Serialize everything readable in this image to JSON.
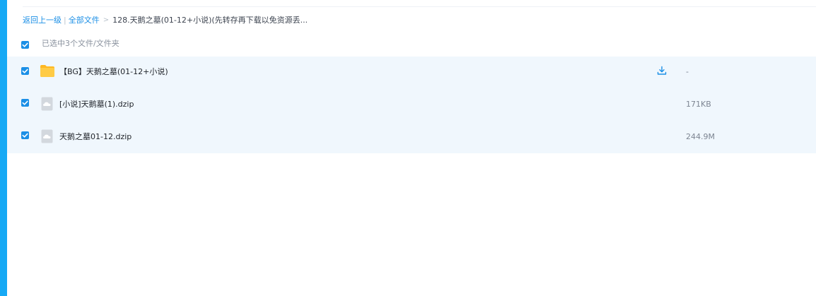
{
  "breadcrumb": {
    "back_label": "返回上一级",
    "separator": "|",
    "all_files_label": "全部文件",
    "arrow": ">",
    "current_folder": "128.天鹅之墓(01-12+小说)(先转存再下载以免资源丢..."
  },
  "selection": {
    "checked": true,
    "summary": "已选中3个文件/文件夹"
  },
  "files": [
    {
      "name": "【BG】天鹅之墓(01-12+小说)",
      "type": "folder",
      "size": "-",
      "checked": true,
      "icon": "folder-icon",
      "has_download": true
    },
    {
      "name": "[小说]天鹅墓(1).dzip",
      "type": "file",
      "size": "171KB",
      "checked": true,
      "icon": "cloud-file-icon",
      "has_download": false
    },
    {
      "name": "天鹅之墓01-12.dzip",
      "type": "file",
      "size": "244.9M",
      "checked": true,
      "icon": "cloud-file-icon",
      "has_download": false
    }
  ],
  "colors": {
    "accent": "#16a9f5",
    "link": "#1b8fe6",
    "row_background": "#f0f7fd",
    "folder": "#ffc53d"
  }
}
